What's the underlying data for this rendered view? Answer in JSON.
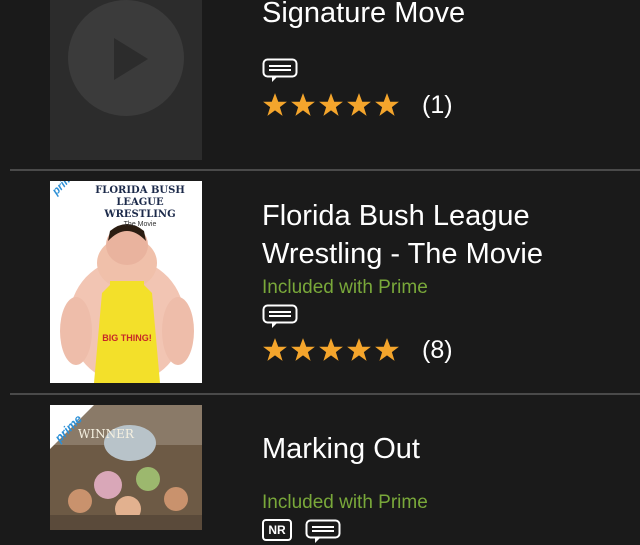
{
  "items": [
    {
      "title": "Signature Move",
      "rating_count": "(1)",
      "stars": 5
    },
    {
      "title": "Florida Bush League Wrestling - The Movie",
      "included": "Included with Prime",
      "rating_count": "(8)",
      "stars": 5,
      "poster": {
        "badge": "prime",
        "headline": "FLORIDA BUSH LEAGUE WRESTLING",
        "tagline": "The Movie",
        "belly_text": "BIG THING!"
      }
    },
    {
      "title": "Marking Out",
      "included": "Included with Prime",
      "rating_badge": "NR",
      "poster": {
        "badge": "prime",
        "corner_text": "WINNER"
      }
    }
  ],
  "colors": {
    "background": "#1a1a1a",
    "prime_green": "#79a83a",
    "star": "#f4a52c",
    "divider": "#4a4a4a"
  },
  "icons": {
    "play": "play-icon",
    "captions": "closed-captions-icon",
    "star": "star-icon"
  }
}
